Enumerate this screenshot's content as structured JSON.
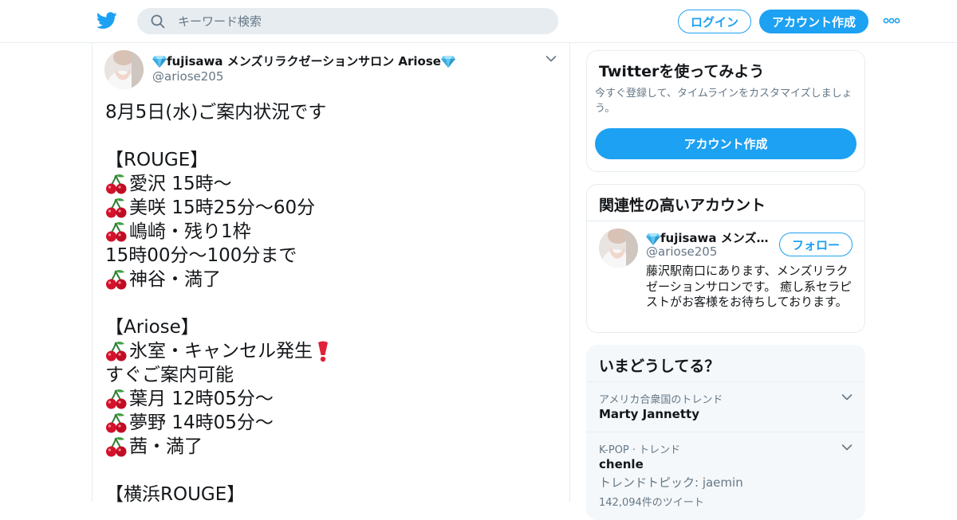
{
  "header": {
    "search_placeholder": "キーワード検索",
    "login_label": "ログイン",
    "signup_label": "アカウント作成"
  },
  "tweet": {
    "display_name": "fujisawa メンズリラクゼーションサロン Ariose",
    "handle": "@ariose205",
    "lines": [
      {
        "cherry": false,
        "text": "8月5日(水)ご案内状況です"
      },
      {
        "cherry": false,
        "text": ""
      },
      {
        "cherry": false,
        "text": "【ROUGE】"
      },
      {
        "cherry": true,
        "text": "愛沢 15時～"
      },
      {
        "cherry": true,
        "text": "美咲 15時25分～60分"
      },
      {
        "cherry": true,
        "text": "嶋崎・残り1枠"
      },
      {
        "cherry": false,
        "text": "15時00分～100分まで"
      },
      {
        "cherry": true,
        "text": "神谷・満了"
      },
      {
        "cherry": false,
        "text": ""
      },
      {
        "cherry": false,
        "text": "【Ariose】"
      },
      {
        "cherry": true,
        "text": "氷室・キャンセル発生",
        "exclaim": true
      },
      {
        "cherry": false,
        "text": "すぐご案内可能"
      },
      {
        "cherry": true,
        "text": "葉月 12時05分～"
      },
      {
        "cherry": true,
        "text": "夢野 14時05分～"
      },
      {
        "cherry": true,
        "text": "茜・満了"
      },
      {
        "cherry": false,
        "text": ""
      },
      {
        "cherry": false,
        "text": "【横浜ROUGE】"
      }
    ]
  },
  "signup_card": {
    "title": "Twitterを使ってみよう",
    "subtitle": "今すぐ登録して、タイムラインをカスタマイズしましょう。",
    "button_label": "アカウント作成"
  },
  "related_card": {
    "title": "関連性の高いアカウント",
    "account_name": "fujisawa メンズリラクゼーションサロン Ariose",
    "account_handle": "@ariose205",
    "follow_label": "フォロー",
    "bio": "藤沢駅南口にあります、メンズリラクゼーションサロンです。 癒し系セラピストがお客様をお待ちしております。"
  },
  "trends_card": {
    "title": "いまどうしてる？",
    "trends": [
      {
        "meta": "アメリカ合衆国のトレンド",
        "name": "Marty Jannetty"
      },
      {
        "meta": "K-POP · トレンド",
        "name": "chenle",
        "sub": "トレンドトピック: jaemin",
        "count": "142,094件のツイート"
      }
    ]
  },
  "colors": {
    "brand_blue": "#1da1f2",
    "secondary_text": "#657786",
    "border": "#e6ecf0",
    "cherry_red": "#d4122a",
    "diamond_blue": "#5cc8f5"
  }
}
